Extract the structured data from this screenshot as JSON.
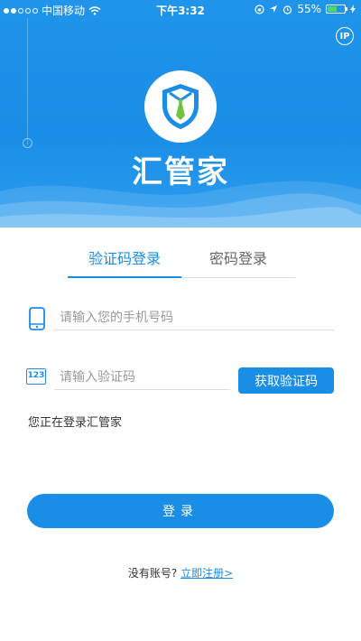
{
  "status_bar": {
    "carrier": "中国移动",
    "time": "下午3:32",
    "battery": "55%",
    "battery_level": 0.55
  },
  "header": {
    "ip_label": "IP",
    "app_name": "汇管家"
  },
  "tabs": [
    {
      "label": "验证码登录",
      "active": true
    },
    {
      "label": "密码登录",
      "active": false
    }
  ],
  "form": {
    "phone_placeholder": "请输入您的手机号码",
    "code_placeholder": "请输入验证码",
    "code_icon_text": "123",
    "get_code_label": "获取验证码",
    "hint": "您正在登录汇管家",
    "login_label": "登录"
  },
  "footer": {
    "no_account": "没有账号?",
    "register_link": "立即注册>"
  },
  "colors": {
    "primary": "#1a8de6",
    "battery": "#4cd964",
    "tie": "#6fc23d"
  }
}
